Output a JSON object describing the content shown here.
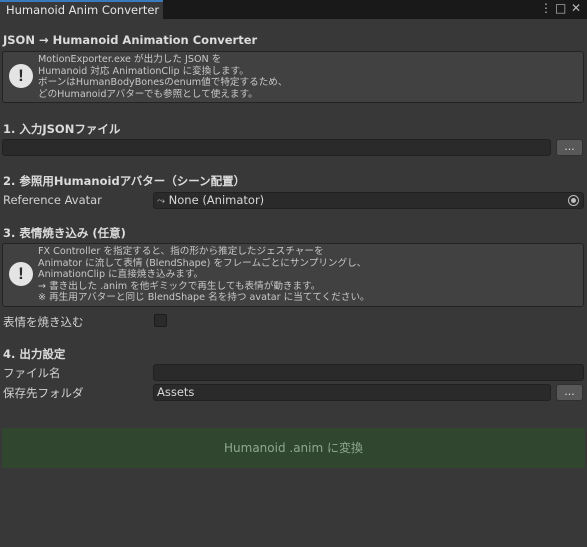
{
  "window": {
    "tab_title": "Humanoid Anim Converter",
    "menu_icon": "kebab-menu-icon",
    "maximize_icon": "maximize-icon",
    "close_icon": "close-icon"
  },
  "header": {
    "title": "JSON → Humanoid Animation Converter",
    "help_lines": [
      "MotionExporter.exe が出力した JSON を",
      "Humanoid 対応 AnimationClip に変換します。",
      "ボーンはHumanBodyBonesのenum値で特定するため、",
      "どのHumanoidアバターでも参照として使えます。"
    ]
  },
  "section1": {
    "title": "1. 入力JSONファイル",
    "path_value": "",
    "browse_label": "..."
  },
  "section2": {
    "title": "2. 参照用Humanoidアバター（シーン配置）",
    "field_label": "Reference Avatar",
    "field_value": "None (Animator)",
    "object_icon": "animator-object-icon",
    "picker_icon": "object-picker-icon"
  },
  "section3": {
    "title": "3. 表情焼き込み (任意)",
    "help_lines": [
      "FX Controller を指定すると、指の形から推定したジェスチャーを",
      "Animator に流して表情 (BlendShape) をフレームごとにサンプリングし、",
      "AnimationClip に直接焼き込みます。",
      "→ 書き出した .anim を他ギミックで再生しても表情が動きます。",
      "※ 再生用アバターと同じ BlendShape 名を持つ avatar に当ててください。"
    ],
    "bake_label": "表情を焼き込む",
    "bake_checked": false
  },
  "section4": {
    "title": "4. 出力設定",
    "filename_label": "ファイル名",
    "filename_value": "",
    "folder_label": "保存先フォルダ",
    "folder_value": "Assets",
    "browse_label": "..."
  },
  "convert_button": "Humanoid .anim に変換",
  "colors": {
    "panel_bg": "#383838",
    "tab_accent": "#3a79bb",
    "convert_bg": "#30462f",
    "convert_text": "#8ea88d"
  }
}
